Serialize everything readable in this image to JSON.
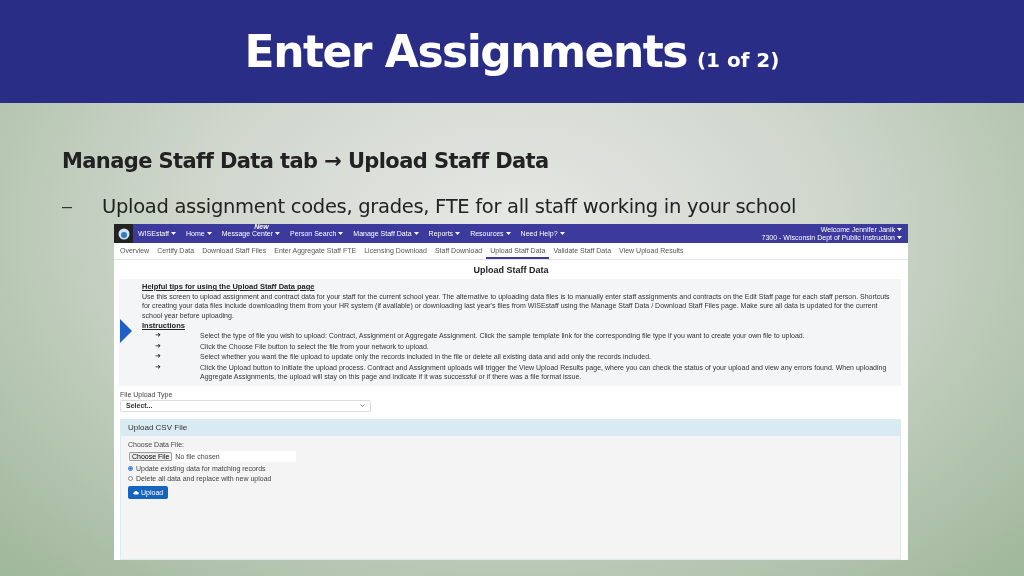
{
  "slide": {
    "title": "Enter Assignments",
    "title_note": "(1 of 2)",
    "heading": "Manage Staff Data tab → Upload Staff Data",
    "bullet_mark": "–",
    "bullet": "Upload assignment codes, grades, FTE for all staff working in your school"
  },
  "screenshot": {
    "nav": [
      {
        "label": "WISEstaff"
      },
      {
        "label": "Home"
      },
      {
        "label": "Message Center",
        "badge": "New"
      },
      {
        "label": "Person Search"
      },
      {
        "label": "Manage Staff Data"
      },
      {
        "label": "Reports"
      },
      {
        "label": "Resources"
      },
      {
        "label": "Need Help?"
      }
    ],
    "user": [
      "Welcome Jennifer Janik",
      "7300 - Wisconsin Dept of Public Instruction"
    ],
    "tabs": [
      {
        "label": "Overview",
        "selected": false
      },
      {
        "label": "Certify Data",
        "selected": false
      },
      {
        "label": "Download Staff Files",
        "selected": false
      },
      {
        "label": "Enter Aggregate Staff FTE",
        "selected": false
      },
      {
        "label": "Licensing Download",
        "selected": false
      },
      {
        "label": "Staff Download",
        "selected": false
      },
      {
        "label": "Upload Staff Data",
        "selected": true
      },
      {
        "label": "Validate Staff Data",
        "selected": false
      },
      {
        "label": "View Upload Results",
        "selected": false
      }
    ],
    "page_title": "Upload Staff Data",
    "tips_title": "Helpful tips for using the Upload Staff Data page",
    "tips_text": "Use this screen to upload assignment and contract data for your staff for the current school year. The alternative to uploading data files is to manually enter staff assignments and contracts on the Edit Staff page for each staff person. Shortcuts for creating your data files include downloading them from your HR system (if available) or downloading last year's files from WISEstaff using the Manage Staff Data / Download Staff Files page. Make sure all data is updated for the current school year before uploading.",
    "instructions_title": "Instructions",
    "instructions": [
      {
        "arrow": "➜",
        "text": "Select the type of file you wish to upload: Contract, Assignment or Aggregate Assignment. Click the sample template link for the corresponding file type if you want to create your own file to upload."
      },
      {
        "arrow": "➜",
        "text": "Click the Choose File button to select the file from your network to upload."
      },
      {
        "arrow": "➜",
        "text": "Select whether you want the file upload to update only the records included in the file or delete all existing data and add only the records included."
      },
      {
        "arrow": "➜",
        "text": "Click the Upload button to initiate the upload process. Contract and Assignment uploads will trigger the View Upload Results page, where you can check the status of your upload and view any errors found. When uploading Aggregate Assignments, the upload will stay on this page and indicate if it was successful or if there was a file format issue."
      }
    ],
    "file_type_label": "File Upload Type",
    "file_type_value": "Select...",
    "panel_title": "Upload CSV File",
    "choose_label": "Choose Data File:",
    "choose_button": "Choose File",
    "file_status": "No file chosen",
    "options": [
      {
        "label": "Update existing data for matching records",
        "selected": true
      },
      {
        "label": "Delete all data and replace with new upload",
        "selected": false
      }
    ],
    "upload_button": "Upload"
  }
}
